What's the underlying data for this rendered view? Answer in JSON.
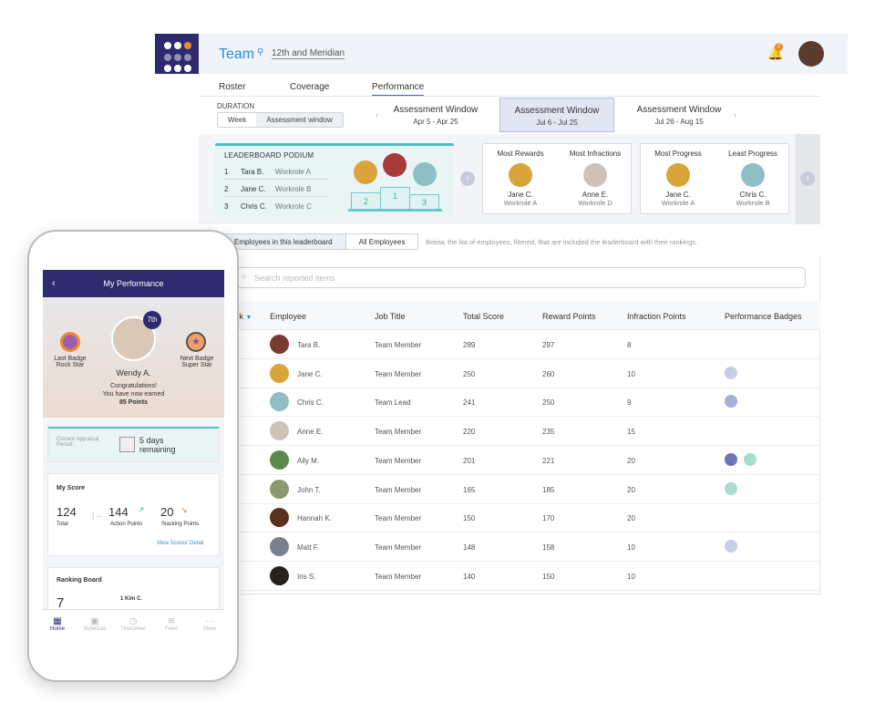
{
  "header": {
    "team": "Team",
    "location": "12th and Meridian",
    "notification_count": "2"
  },
  "tabs": [
    {
      "label": "Roster"
    },
    {
      "label": "Coverage"
    },
    {
      "label": "Performance",
      "active": true
    }
  ],
  "duration": {
    "label": "DURATION",
    "options": [
      "Week",
      "Assessment window"
    ],
    "selected": "Assessment window"
  },
  "windows": [
    {
      "title": "Assessment Window",
      "range": "Apr 5 - Apr 25"
    },
    {
      "title": "Assessment Window",
      "range": "Jul 6 - Jul 25",
      "selected": true
    },
    {
      "title": "Assessment Window",
      "range": "Jul 26 - Aug 15"
    }
  ],
  "podium": {
    "title": "LEADERBOARD PODIUM",
    "rows": [
      {
        "rank": "1",
        "name": "Tara B.",
        "role": "Workrole A"
      },
      {
        "rank": "2",
        "name": "Jane C.",
        "role": "Workrole B"
      },
      {
        "rank": "3",
        "name": "Chris C.",
        "role": "Workrole C"
      }
    ],
    "steps": [
      "2",
      "1",
      "3"
    ]
  },
  "cards": [
    [
      {
        "label": "Most Rewards",
        "name": "Jane C.",
        "role": "Workrole A"
      },
      {
        "label": "Most Infractions",
        "name": "Anne E.",
        "role": "Workrole D"
      }
    ],
    [
      {
        "label": "Most Progress",
        "name": "Jane C.",
        "role": "Workrole A"
      },
      {
        "label": "Least Progress",
        "name": "Chris C.",
        "role": "Workrole B"
      }
    ]
  ],
  "filter": {
    "options": [
      "Employees in this leaderboard",
      "All Employees"
    ],
    "selected": "Employees in this leaderboard",
    "hint": "Below, the list of employees, filtered, that are included the leaderboard with their rankings."
  },
  "search": {
    "placeholder": "Search reported items"
  },
  "table": {
    "columns": [
      "Rank",
      "Employee",
      "Job Title",
      "Total Score",
      "Reward Points",
      "Infraction Points",
      "Performance Badges"
    ],
    "rows": [
      {
        "name": "Tara B.",
        "job": "Team Member",
        "total": "289",
        "reward": "297",
        "infraction": "8",
        "badges": []
      },
      {
        "name": "Jane C.",
        "job": "Team Member",
        "total": "250",
        "reward": "260",
        "infraction": "10",
        "badges": [
          "handshake"
        ]
      },
      {
        "name": "Chris C.",
        "job": "Team Lead",
        "total": "241",
        "reward": "250",
        "infraction": "9",
        "badges": [
          "trophy"
        ]
      },
      {
        "name": "Anne E.",
        "job": "Team Member",
        "total": "220",
        "reward": "235",
        "infraction": "15",
        "badges": []
      },
      {
        "name": "Ally M.",
        "job": "Team Member",
        "total": "201",
        "reward": "221",
        "infraction": "20",
        "badges": [
          "pencil",
          "mountain-flag"
        ]
      },
      {
        "name": "John T.",
        "job": "Team Member",
        "total": "165",
        "reward": "185",
        "infraction": "20",
        "badges": [
          "mountain-flag"
        ]
      },
      {
        "name": "Hannah K.",
        "job": "Team Member",
        "total": "150",
        "reward": "170",
        "infraction": "20",
        "badges": []
      },
      {
        "name": "Matt F.",
        "job": "Team Member",
        "total": "148",
        "reward": "158",
        "infraction": "10",
        "badges": [
          "handshake"
        ]
      },
      {
        "name": "Iris S.",
        "job": "Team Member",
        "total": "140",
        "reward": "150",
        "infraction": "10",
        "badges": []
      }
    ]
  },
  "phone": {
    "title": "My Performance",
    "rank": "7th",
    "last_badge_label": "Last Badge",
    "last_badge": "Rock Star",
    "next_badge_label": "Next Badge",
    "next_badge": "Super Star",
    "user": "Wendy A.",
    "congrats": "Congratulations!",
    "earned": "You have now earned",
    "points": "85 Points",
    "appraisal_label": "Current Appraisal Period:",
    "days": "5 days",
    "remaining": "remaining",
    "score_title": "My Score",
    "total": "124",
    "total_label": "Total",
    "action": "144",
    "action_label": "Action Points",
    "slacking": "20",
    "slacking_label": "Slacking Points",
    "detail_link": "View Scores' Detail",
    "ranking_title": "Ranking Board",
    "ranking_value": "7",
    "ranking_first": "1   Kim C.",
    "nav": [
      "Home",
      "Schedule",
      "Timesheet",
      "Feed",
      "More"
    ]
  },
  "colors": {
    "brand": "#2d2a6e",
    "accent": "#2b8fd6",
    "teal": "#4cc1bd",
    "up": "#3bb56a",
    "down": "#e8734a"
  }
}
